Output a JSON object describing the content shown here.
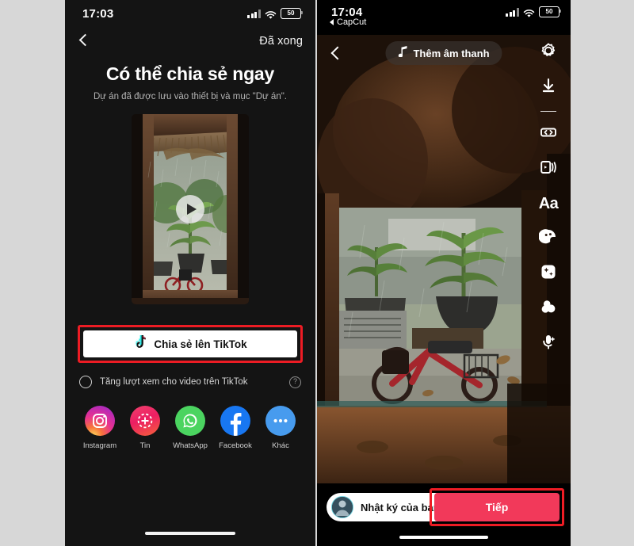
{
  "left_phone": {
    "status": {
      "time": "17:03",
      "battery": "50",
      "signal_icon": "cellular-signal-icon",
      "wifi_icon": "wifi-icon",
      "battery_icon": "battery-icon"
    },
    "nav": {
      "back_icon": "chevron-left-icon",
      "done_label": "Đã xong"
    },
    "title": "Có thể chia sẻ ngay",
    "subtitle": "Dự án đã được lưu vào thiết bị và mục \"Dự án\".",
    "preview": {
      "play_icon": "play-icon"
    },
    "tiktok_share": {
      "label": "Chia sẻ lên TikTok",
      "icon": "tiktok-icon",
      "highlight_color": "#ed1c24"
    },
    "boost": {
      "label": "Tăng lượt xem cho video trên TikTok",
      "radio_icon": "radio-unchecked-icon",
      "help_icon": "question-mark-icon"
    },
    "share_apps": [
      {
        "name": "Instagram",
        "icon": "instagram-icon"
      },
      {
        "name": "Tin",
        "icon": "stories-icon"
      },
      {
        "name": "WhatsApp",
        "icon": "whatsapp-icon"
      },
      {
        "name": "Facebook",
        "icon": "facebook-icon"
      },
      {
        "name": "Khác",
        "icon": "more-dots-icon"
      }
    ],
    "home_indicator": "home-indicator"
  },
  "right_phone": {
    "status": {
      "time": "17:04",
      "battery": "50",
      "return_app": "CapCut",
      "signal_icon": "cellular-signal-icon",
      "wifi_icon": "wifi-icon",
      "battery_icon": "battery-icon"
    },
    "topbar": {
      "back_icon": "chevron-left-icon",
      "sound_label": "Thêm âm thanh",
      "sound_icon": "music-note-icon"
    },
    "sidebar": [
      {
        "icon": "flash-settings-icon",
        "name": "adjust-clips"
      },
      {
        "icon": "download-icon",
        "name": "download"
      },
      {
        "divider": true
      },
      {
        "icon": "flip-icon",
        "name": "flip"
      },
      {
        "icon": "templates-icon",
        "name": "templates"
      },
      {
        "icon": "text-aa-icon",
        "name": "text",
        "label": "Aa"
      },
      {
        "icon": "sticker-icon",
        "name": "stickers"
      },
      {
        "icon": "enhance-sparkle-icon",
        "name": "enhance"
      },
      {
        "icon": "filters-icon",
        "name": "filters"
      },
      {
        "icon": "voice-effects-icon",
        "name": "voice-effects"
      }
    ],
    "bottom": {
      "diary_label": "Nhật ký của bạn",
      "diary_avatar": "user-avatar",
      "next_label": "Tiếp",
      "next_color": "#f2395a",
      "highlight_color": "#ed1c24"
    },
    "home_indicator": "home-indicator"
  }
}
